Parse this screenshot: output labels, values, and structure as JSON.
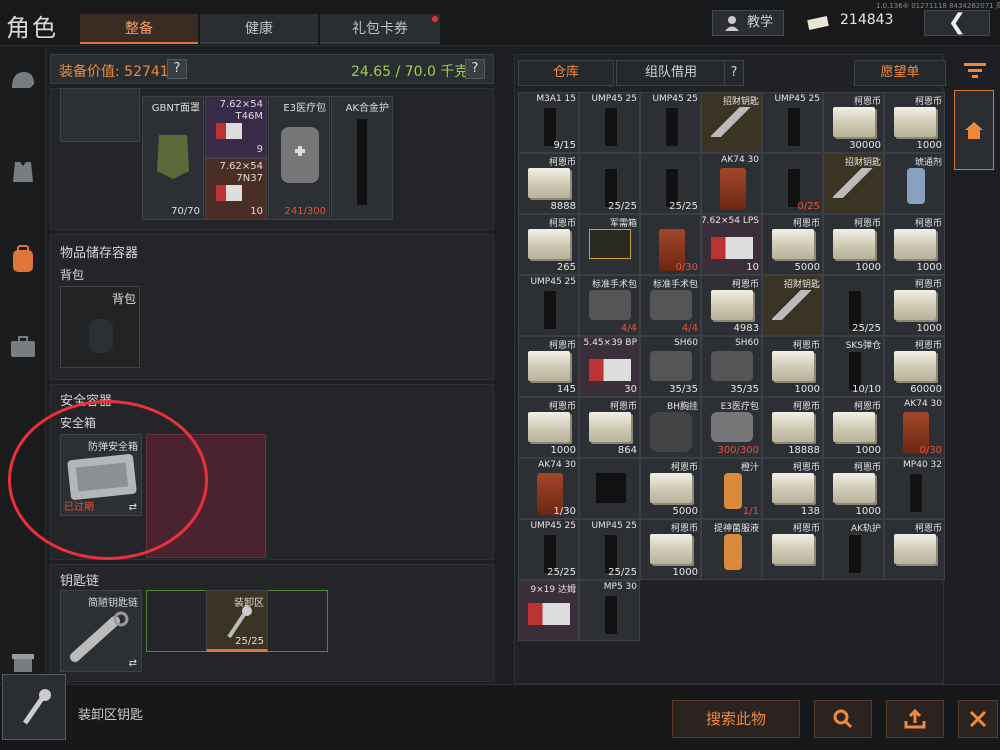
{
  "header": {
    "title": "角色",
    "tabs": [
      "整备",
      "健康",
      "礼包卡券"
    ],
    "active_tab": 0,
    "tutorial": "教学",
    "currency": "214843",
    "version": "1.0.136⑥ 01271118 8434262071 高清",
    "back_icon": "back-arrow-icon"
  },
  "left": {
    "equip_value": "装备价值: 52741",
    "weight": "24.65 / 70.0 千克",
    "help": "?",
    "top_items": [
      {
        "name": "GBNT面罩",
        "count": "70/70"
      },
      {
        "name": "7.62×54",
        "sub": "T46M",
        "count": "9"
      },
      {
        "name": "7.62×54",
        "sub": "7N37",
        "count": "10"
      },
      {
        "name": "E3医疗包",
        "count": "241/300"
      },
      {
        "name": "AK合金护",
        "count": ""
      }
    ],
    "storage_title": "物品储存容器",
    "backpack_label": "背包",
    "backpack_slot": "背包",
    "safe_title": "安全容器",
    "safe_sub": "安全箱",
    "safe_item": "防弹安全箱",
    "safe_status": "已过期",
    "keychain_title": "钥匙链",
    "keychain_item": "简陋钥匙链",
    "keychain_key": "装卸区",
    "keychain_count": "25/25"
  },
  "right": {
    "tabs": [
      "仓库",
      "组队借用"
    ],
    "wishlist": "愿望单",
    "help": "?"
  },
  "grid": [
    {
      "n": "M3A1 15",
      "c": "9/15",
      "k": "mag"
    },
    {
      "n": "UMP45 25",
      "c": "",
      "k": "mag"
    },
    {
      "n": "UMP45 25",
      "c": "",
      "k": "mag"
    },
    {
      "n": "招财钥匙",
      "c": "",
      "k": "key"
    },
    {
      "n": "UMP45 25",
      "c": "",
      "k": "mag"
    },
    {
      "n": "柯恩币",
      "c": "30000",
      "k": "cash"
    },
    {
      "n": "柯恩币",
      "c": "1000",
      "k": "cash"
    },
    {
      "n": "柯恩币",
      "c": "8888",
      "k": "cash"
    },
    {
      "n": "",
      "c": "25/25",
      "k": "mag"
    },
    {
      "n": "",
      "c": "25/25",
      "k": "mag"
    },
    {
      "n": "AK74 30",
      "c": "",
      "k": "rust"
    },
    {
      "n": "",
      "c": "0/25",
      "k": "mag"
    },
    {
      "n": "招财钥匙",
      "c": "",
      "k": "key"
    },
    {
      "n": "琥通剂",
      "c": "",
      "k": "med"
    },
    {
      "n": "柯恩币",
      "c": "265",
      "k": "cash"
    },
    {
      "n": "军需箱",
      "c": "",
      "k": "crate"
    },
    {
      "n": "",
      "c": "0/30",
      "k": "rust"
    },
    {
      "n": "7.62×54 LPS",
      "c": "10",
      "k": "ammo"
    },
    {
      "n": "柯恩币",
      "c": "5000",
      "k": "cash"
    },
    {
      "n": "柯恩币",
      "c": "1000",
      "k": "cash"
    },
    {
      "n": "柯恩币",
      "c": "1000",
      "k": "cash"
    },
    {
      "n": "UMP45 25",
      "c": "",
      "k": "mag"
    },
    {
      "n": "标准手术包",
      "c": "4/4",
      "k": "bag"
    },
    {
      "n": "标准手术包",
      "c": "4/4",
      "k": "bag"
    },
    {
      "n": "柯恩币",
      "c": "4983",
      "k": "cash"
    },
    {
      "n": "招财钥匙",
      "c": "",
      "k": "key"
    },
    {
      "n": "",
      "c": "25/25",
      "k": "mag"
    },
    {
      "n": "柯恩币",
      "c": "1000",
      "k": "cash"
    },
    {
      "n": "柯恩币",
      "c": "145",
      "k": "cash"
    },
    {
      "n": "5.45×39 BP",
      "c": "30",
      "k": "ammo"
    },
    {
      "n": "SH60",
      "c": "35/35",
      "k": "belt"
    },
    {
      "n": "SH60",
      "c": "35/35",
      "k": "belt"
    },
    {
      "n": "柯恩币",
      "c": "1000",
      "k": "cash"
    },
    {
      "n": "SKS弹仓",
      "c": "10/10",
      "k": "mag"
    },
    {
      "n": "柯恩币",
      "c": "60000",
      "k": "cash"
    },
    {
      "n": "柯恩币",
      "c": "1000",
      "k": "cash"
    },
    {
      "n": "柯恩币",
      "c": "864",
      "k": "cash"
    },
    {
      "n": "BH胸挂",
      "c": "",
      "k": "vest"
    },
    {
      "n": "E3医疗包",
      "c": "300/300",
      "k": "med2"
    },
    {
      "n": "柯恩币",
      "c": "18888",
      "k": "cash"
    },
    {
      "n": "柯恩币",
      "c": "1000",
      "k": "cash"
    },
    {
      "n": "AK74 30",
      "c": "0/30",
      "k": "rust"
    },
    {
      "n": "AK74 30",
      "c": "1/30",
      "k": "rust"
    },
    {
      "n": "",
      "c": "",
      "k": "mystery"
    },
    {
      "n": "柯恩币",
      "c": "5000",
      "k": "cash"
    },
    {
      "n": "橙汁",
      "c": "1/1",
      "k": "juice"
    },
    {
      "n": "柯恩币",
      "c": "138",
      "k": "cash"
    },
    {
      "n": "柯恩币",
      "c": "1000",
      "k": "cash"
    },
    {
      "n": "MP40 32",
      "c": "",
      "k": "mag"
    },
    {
      "n": "UMP45 25",
      "c": "25/25",
      "k": "mag"
    },
    {
      "n": "UMP45 25",
      "c": "25/25",
      "k": "mag"
    },
    {
      "n": "柯恩币",
      "c": "1000",
      "k": "cash"
    },
    {
      "n": "提神菌服液",
      "c": "",
      "k": "juice"
    },
    {
      "n": "柯恩币",
      "c": "",
      "k": "cash"
    },
    {
      "n": "AK轨护",
      "c": "",
      "k": "mag"
    },
    {
      "n": "柯恩币",
      "c": "",
      "k": "cash"
    },
    {
      "n": "9×19 达姆",
      "c": "",
      "k": "ammo"
    },
    {
      "n": "MP5 30",
      "c": "",
      "k": "mag"
    }
  ],
  "bottom": {
    "selected": "装卸区钥匙",
    "search": "搜索此物"
  }
}
